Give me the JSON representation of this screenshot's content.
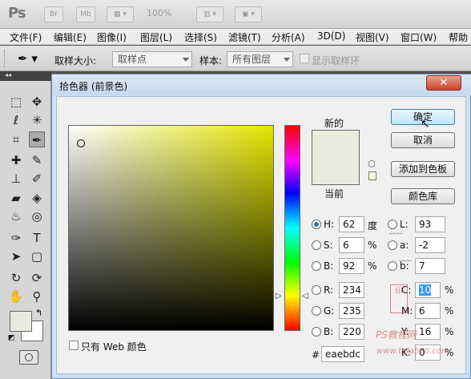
{
  "appbar": {
    "logo": "Ps",
    "bridge_label": "Br",
    "minibridge_label": "Mb",
    "zoom": "100%"
  },
  "menu": [
    "文件(F)",
    "编辑(E)",
    "图像(I)",
    "图层(L)",
    "选择(S)",
    "滤镜(T)",
    "分析(A)",
    "3D(D)",
    "视图(V)",
    "窗口(W)",
    "帮助"
  ],
  "options": {
    "sample_size_label": "取样大小:",
    "sample_size_value": "取样点",
    "sample_label": "样本:",
    "sample_value": "所有图层",
    "show_ring_label": "显示取样环"
  },
  "dialog": {
    "title": "拾色器 (前景色)",
    "new_label": "新的",
    "current_label": "当前",
    "new_color": "#eaebdc",
    "current_color": "#eaebdc",
    "buttons": {
      "ok": "确定",
      "cancel": "取消",
      "add_to_swatches": "添加到色板",
      "color_libraries": "颜色库"
    },
    "web_only_label": "只有 Web 颜色",
    "hsb": [
      {
        "label": "H:",
        "value": "62",
        "unit": "度",
        "selected": true
      },
      {
        "label": "S:",
        "value": "6",
        "unit": "%",
        "selected": false
      },
      {
        "label": "B:",
        "value": "92",
        "unit": "%",
        "selected": false
      }
    ],
    "rgb": [
      {
        "label": "R:",
        "value": "234"
      },
      {
        "label": "G:",
        "value": "235"
      },
      {
        "label": "B:",
        "value": "220"
      }
    ],
    "lab": [
      {
        "label": "L:",
        "value": "93"
      },
      {
        "label": "a:",
        "value": "-2"
      },
      {
        "label": "b:",
        "value": "7"
      }
    ],
    "cmyk": [
      {
        "label": "C:",
        "value": "10",
        "unit": "%"
      },
      {
        "label": "M:",
        "value": "6",
        "unit": "%"
      },
      {
        "label": "Y:",
        "value": "16",
        "unit": "%"
      },
      {
        "label": "K:",
        "value": "0",
        "unit": "%"
      }
    ],
    "hex_label": "#",
    "hex_value": "eaebdc"
  },
  "watermark": {
    "site_text": "PS教程网",
    "url_text": "www.tata580.com"
  }
}
